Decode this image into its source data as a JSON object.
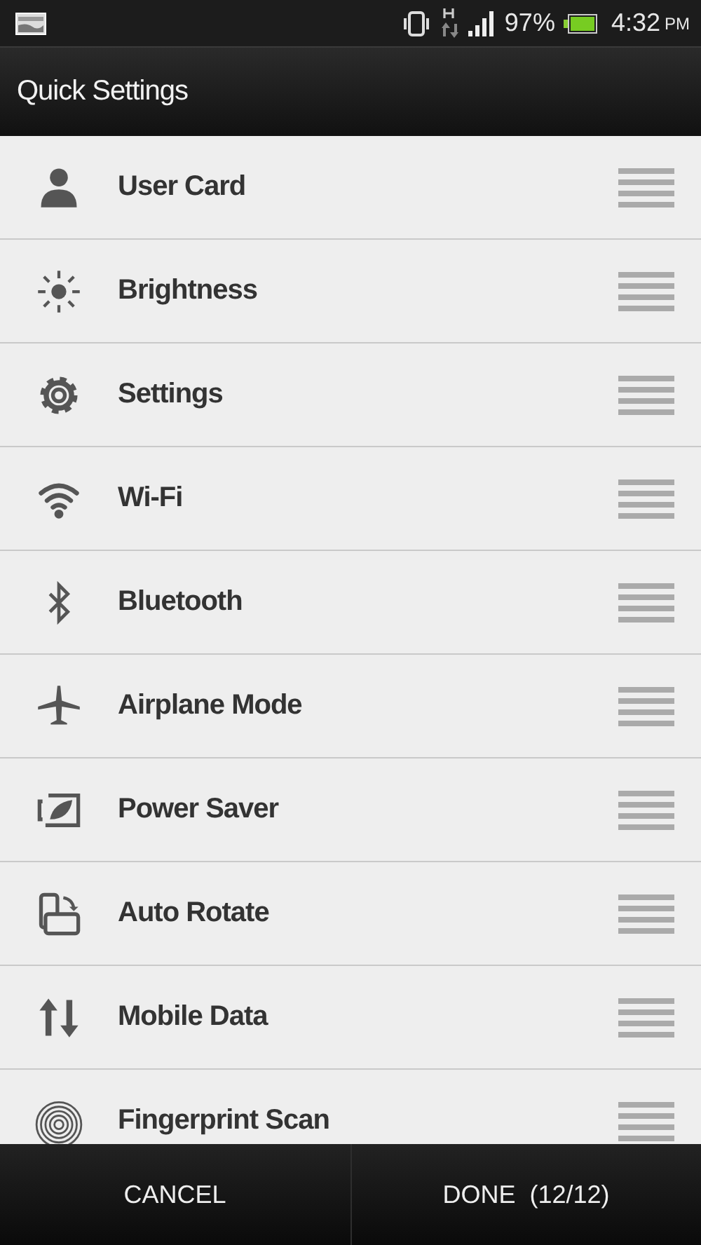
{
  "status_bar": {
    "battery_percent": "97%",
    "time": "4:32",
    "meridiem": "PM"
  },
  "title": "Quick Settings",
  "items": [
    {
      "label": "User Card",
      "kind": "user"
    },
    {
      "label": "Brightness",
      "kind": "brightness"
    },
    {
      "label": "Settings",
      "kind": "settings"
    },
    {
      "label": "Wi-Fi",
      "kind": "wifi"
    },
    {
      "label": "Bluetooth",
      "kind": "bluetooth"
    },
    {
      "label": "Airplane Mode",
      "kind": "airplane"
    },
    {
      "label": "Power Saver",
      "kind": "power"
    },
    {
      "label": "Auto Rotate",
      "kind": "rotate"
    },
    {
      "label": "Mobile Data",
      "kind": "data"
    },
    {
      "label": "Fingerprint Scan",
      "kind": "fingerprint"
    }
  ],
  "buttons": [
    {
      "label": "CANCEL"
    },
    {
      "label": "DONE  (12/12)"
    }
  ]
}
